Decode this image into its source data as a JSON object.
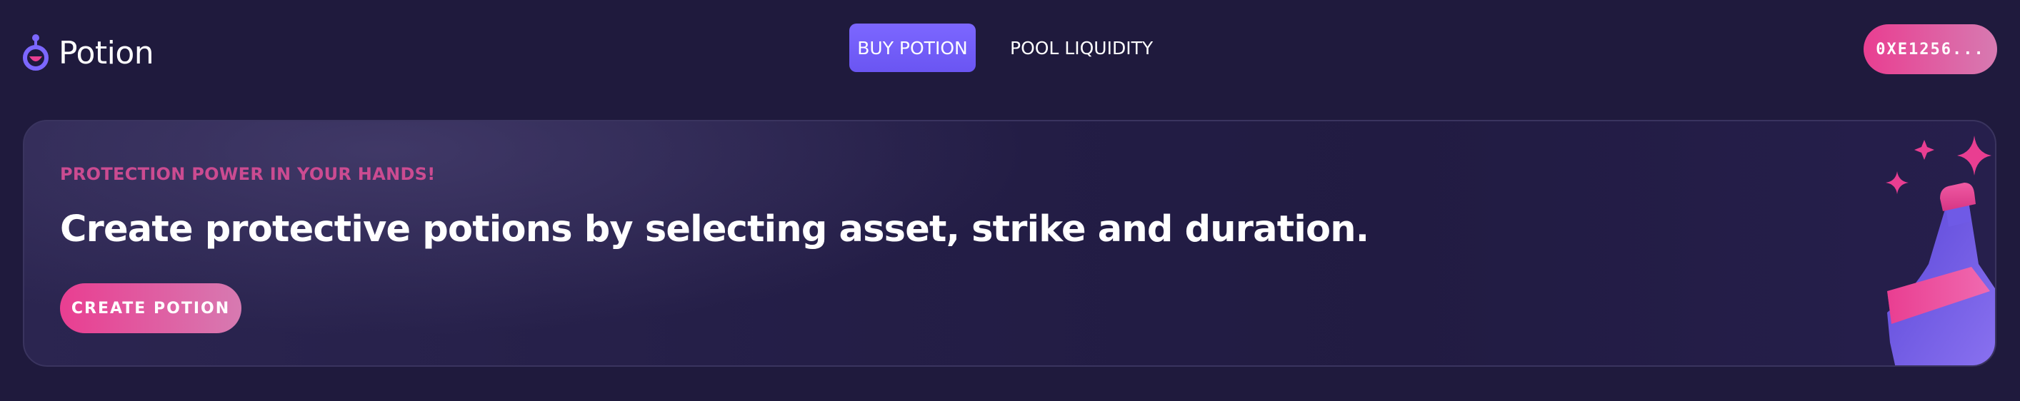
{
  "app": {
    "name": "Potion"
  },
  "header": {
    "logo_icon": "potion-flask-icon",
    "nav": [
      {
        "label": "BUY POTION",
        "active": true
      },
      {
        "label": "POOL LIQUIDITY",
        "active": false
      }
    ],
    "wallet_label": "0XE1256..."
  },
  "hero": {
    "eyebrow": "PROTECTION POWER IN YOUR HANDS!",
    "title": "Create protective potions by selecting asset, strike and duration.",
    "cta_label": "CREATE POTION",
    "illustration_icon": "potion-bottle-sparkles-icon"
  },
  "colors": {
    "background": "#1f1a3d",
    "accent_pink": "#e93e91",
    "accent_purple": "#7c67ff",
    "eyebrow_pink": "#cb4b91"
  }
}
